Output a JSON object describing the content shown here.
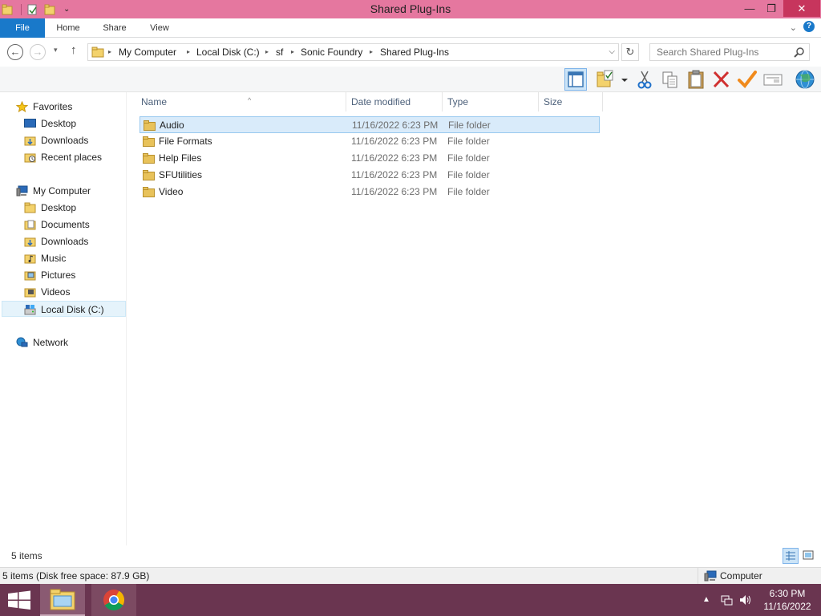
{
  "window": {
    "title": "Shared Plug-Ins",
    "min_glyph": "—",
    "max_glyph": "❐",
    "close_glyph": "✕"
  },
  "ribbon": {
    "tabs": [
      "File",
      "Home",
      "Share",
      "View"
    ],
    "expand_glyph": "⌄",
    "help_glyph": "?"
  },
  "nav": {
    "back_glyph": "←",
    "forward_glyph": "→",
    "recent_glyph": "▾",
    "up_glyph": "↑",
    "refresh_glyph": "↻"
  },
  "address": {
    "breadcrumbs": [
      "My Computer",
      "Local Disk (C:)",
      "sf",
      "Sonic Foundry",
      "Shared Plug-Ins"
    ],
    "sep_glyph": "▸",
    "dropdown_glyph": "⌵"
  },
  "search": {
    "placeholder": "Search Shared Plug-Ins"
  },
  "sidebar": {
    "favorites": {
      "label": "Favorites",
      "items": [
        "Desktop",
        "Downloads",
        "Recent places"
      ]
    },
    "computer": {
      "label": "My Computer",
      "items": [
        "Desktop",
        "Documents",
        "Downloads",
        "Music",
        "Pictures",
        "Videos",
        "Local Disk (C:)"
      ]
    },
    "network": {
      "label": "Network"
    }
  },
  "columns": {
    "name": "Name",
    "date": "Date modified",
    "type": "Type",
    "size": "Size",
    "sort_glyph": "^"
  },
  "files": [
    {
      "name": "Audio",
      "date": "11/16/2022 6:23 PM",
      "type": "File folder"
    },
    {
      "name": "File Formats",
      "date": "11/16/2022 6:23 PM",
      "type": "File folder"
    },
    {
      "name": "Help Files",
      "date": "11/16/2022 6:23 PM",
      "type": "File folder"
    },
    {
      "name": "SFUtilities",
      "date": "11/16/2022 6:23 PM",
      "type": "File folder"
    },
    {
      "name": "Video",
      "date": "11/16/2022 6:23 PM",
      "type": "File folder"
    }
  ],
  "details": {
    "count": "5 items"
  },
  "status": {
    "text": "5 items (Disk free space: 87.9 GB)",
    "zone": "Computer"
  },
  "taskbar": {
    "tray_arrow": "▲",
    "time": "6:30 PM",
    "date": "11/16/2022"
  },
  "colors": {
    "titlebar": "#e5779f",
    "accent": "#1979ca",
    "taskbar": "#6a3550",
    "folder": "#e8c25a"
  }
}
